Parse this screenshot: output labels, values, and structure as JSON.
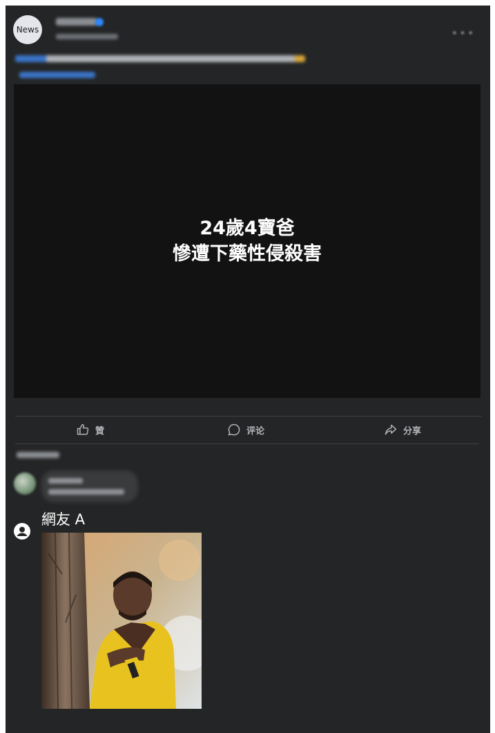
{
  "post": {
    "page_avatar_label": "News",
    "video_line1": "24歲4寶爸",
    "video_line2": "慘遭下藥性侵殺害"
  },
  "actions": {
    "like_label": "贊",
    "comment_label": "评论",
    "share_label": "分享"
  },
  "comment": {
    "author": "網友 A"
  },
  "icons": [
    "more-icon",
    "verified-badge-icon",
    "like-icon",
    "comment-icon",
    "share-icon",
    "user-avatar-icon"
  ],
  "colors": {
    "background": "#242526",
    "video_background": "#121212",
    "text_secondary": "#b0b3b8",
    "link": "#3a74c8"
  }
}
